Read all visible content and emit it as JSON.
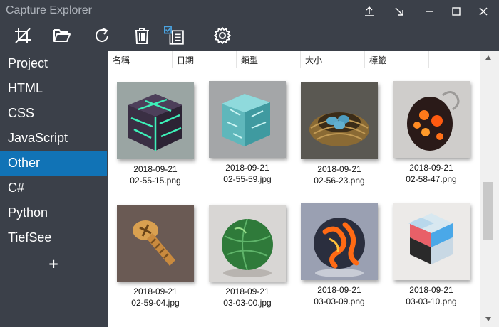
{
  "app": {
    "title": "Capture Explorer"
  },
  "titlebar": {
    "buttons": [
      {
        "icon": "upload-icon"
      },
      {
        "icon": "arrow-down-right-icon"
      },
      {
        "icon": "minimize-icon"
      },
      {
        "icon": "maximize-icon"
      },
      {
        "icon": "close-icon"
      }
    ]
  },
  "toolbar": {
    "tools": [
      {
        "icon": "crop-icon"
      },
      {
        "icon": "open-folder-icon"
      },
      {
        "icon": "refresh-icon"
      },
      {
        "icon": "delete-icon"
      },
      {
        "icon": "multi-select-icon"
      },
      {
        "icon": "gear-icon"
      }
    ]
  },
  "sidebar": {
    "items": [
      {
        "label": "Project",
        "active": false
      },
      {
        "label": "HTML",
        "active": false
      },
      {
        "label": "CSS",
        "active": false
      },
      {
        "label": "JavaScript",
        "active": false
      },
      {
        "label": "Other",
        "active": true
      },
      {
        "label": "C#",
        "active": false
      },
      {
        "label": "Python",
        "active": false
      },
      {
        "label": "TiefSee",
        "active": false
      }
    ],
    "add_label": "+"
  },
  "columns": [
    "名稱",
    "日期",
    "類型",
    "大小",
    "標籤"
  ],
  "files": [
    {
      "date": "2018-09-21",
      "file": "02-55-15.png",
      "icon": "cracked-cube-thumbnail"
    },
    {
      "date": "2018-09-21",
      "file": "02-55-59.jpg",
      "icon": "ice-cube-thumbnail"
    },
    {
      "date": "2018-09-21",
      "file": "02-56-23.png",
      "icon": "bird-nest-thumbnail"
    },
    {
      "date": "2018-09-21",
      "file": "02-58-47.png",
      "icon": "lava-egg-thumbnail"
    },
    {
      "date": "2018-09-21",
      "file": "02-59-04.jpg",
      "icon": "brass-screw-thumbnail"
    },
    {
      "date": "2018-09-21",
      "file": "03-03-00.jpg",
      "icon": "leaf-sphere-thumbnail"
    },
    {
      "date": "2018-09-21",
      "file": "03-03-09.png",
      "icon": "lava-sphere-thumbnail"
    },
    {
      "date": "2018-09-21",
      "file": "03-03-10.png",
      "icon": "color-cubes-thumbnail"
    }
  ],
  "colors": {
    "accent": "#1173b6",
    "sidebar_bg": "#3b4049",
    "title_text": "#aeb3bb"
  }
}
